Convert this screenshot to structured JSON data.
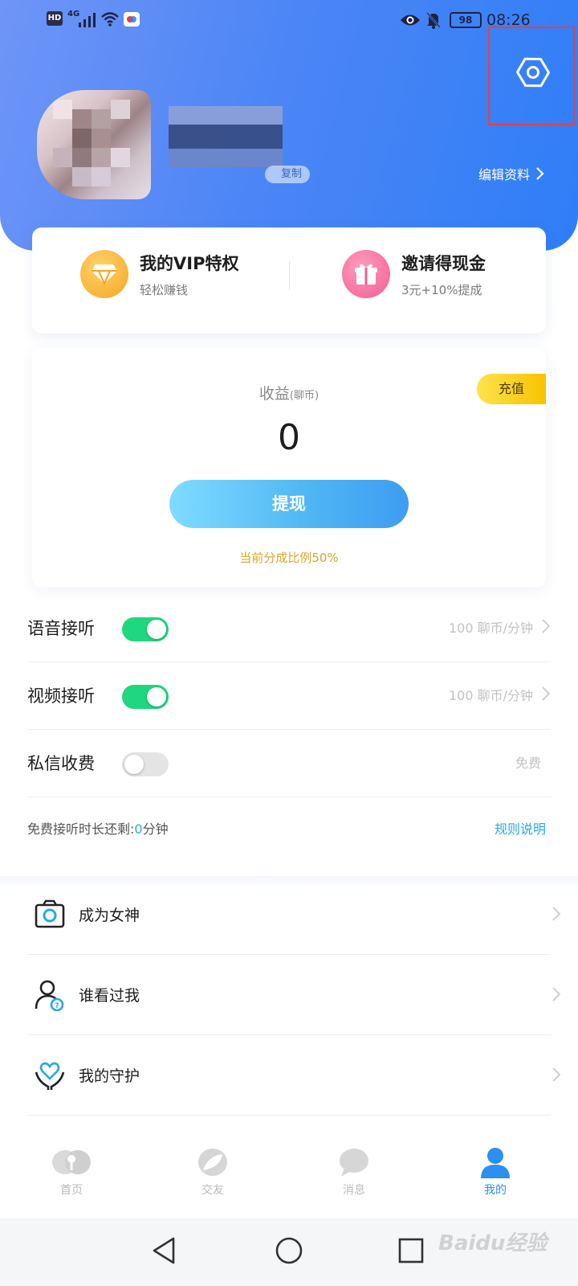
{
  "status_bar": {
    "hd": "HD",
    "network": "4G",
    "battery": "98",
    "time": "08:26"
  },
  "profile": {
    "copy_label": "复制",
    "edit_label": "编辑资料"
  },
  "vip": {
    "vip_title": "我的VIP特权",
    "vip_sub": "轻松赚钱",
    "invite_title": "邀请得现金",
    "invite_sub": "3元+10%提成"
  },
  "earnings": {
    "label": "收益",
    "unit": "(聊币)",
    "value": "0",
    "recharge": "充值",
    "withdraw": "提现",
    "ratio": "当前分成比例50%"
  },
  "settings": {
    "voice": {
      "label": "语音接听",
      "enabled": true,
      "value": "100 聊币/分钟"
    },
    "video": {
      "label": "视频接听",
      "enabled": true,
      "value": "100 聊币/分钟"
    },
    "message": {
      "label": "私信收费",
      "enabled": false,
      "value": "免费"
    },
    "free_time_prefix": "免费接听时长还剩:",
    "free_time_value": "0",
    "free_time_suffix": "分钟",
    "rules": "规则说明"
  },
  "menu": [
    {
      "label": "成为女神",
      "icon": "camera-icon"
    },
    {
      "label": "谁看过我",
      "icon": "visitor-icon"
    },
    {
      "label": "我的守护",
      "icon": "heart-hands-icon"
    }
  ],
  "tabs": [
    {
      "label": "首页",
      "icon": "home-icon",
      "active": false
    },
    {
      "label": "交友",
      "icon": "friends-icon",
      "active": false
    },
    {
      "label": "消息",
      "icon": "message-icon",
      "active": false
    },
    {
      "label": "我的",
      "icon": "profile-icon",
      "active": true
    }
  ],
  "colors": {
    "header_gradient_start": "#6f95f7",
    "header_gradient_end": "#2f7ef7",
    "toggle_on": "#1ed77e",
    "link": "#2aa7e8",
    "ratio": "#d4a72c",
    "tab_active": "#2d8ff0",
    "highlight_box": "#e8403f"
  },
  "watermark": "Baidu经验"
}
